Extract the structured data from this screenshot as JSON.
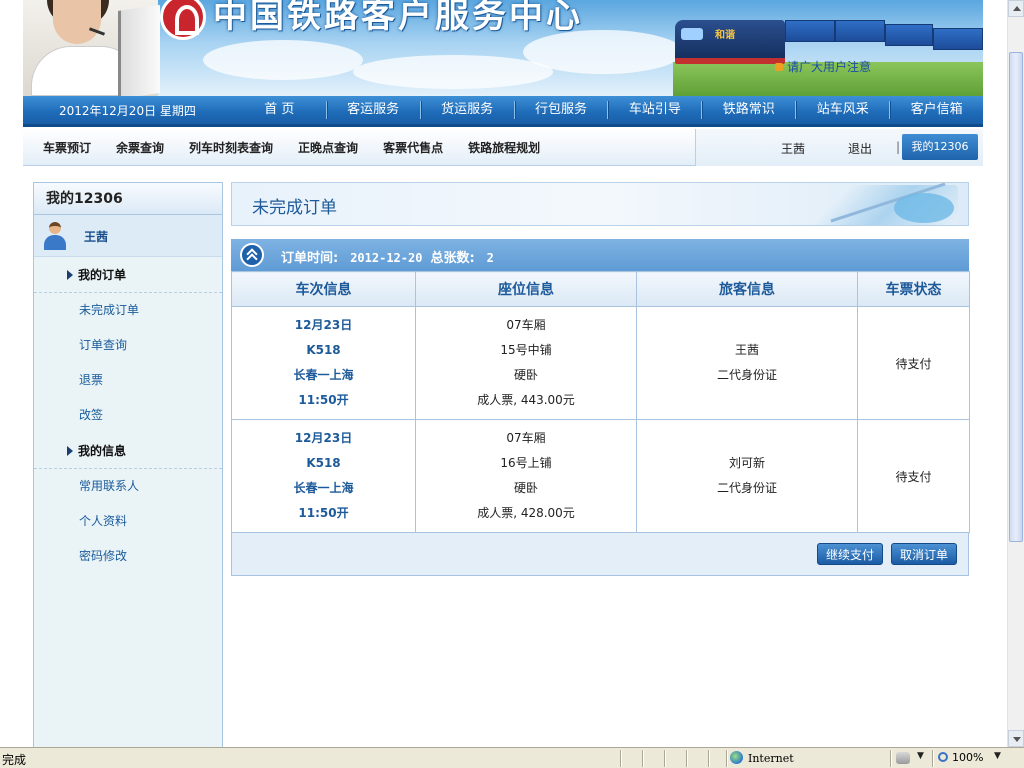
{
  "header": {
    "site_title": "中国铁路客户服务中心",
    "notice": "请广大用户注意",
    "loco_brand": "和谐"
  },
  "main_nav": {
    "date": "2012年12月20日  星期四",
    "items": [
      "首 页",
      "客运服务",
      "货运服务",
      "行包服务",
      "车站引导",
      "铁路常识",
      "站车风采",
      "客户信箱"
    ]
  },
  "sub_nav": {
    "links": [
      "车票预订",
      "余票查询",
      "列车时刻表查询",
      "正晚点查询",
      "客票代售点",
      "铁路旅程规划"
    ],
    "user_name": "王茜",
    "logout": "退出",
    "separator": "|",
    "my12306": "我的12306"
  },
  "sidebar": {
    "title": "我的12306",
    "user_name": "王茜",
    "sections": [
      {
        "label": "我的订单",
        "items": [
          "未完成订单",
          "订单查询",
          "退票",
          "改签"
        ]
      },
      {
        "label": "我的信息",
        "items": [
          "常用联系人",
          "个人资料",
          "密码修改"
        ]
      }
    ]
  },
  "content": {
    "title": "未完成订单",
    "order_bar": {
      "time_label": "订单时间:",
      "time_value": "2012-12-20",
      "count_label": "总张数:",
      "count_value": "2"
    },
    "table": {
      "headers": [
        "车次信息",
        "座位信息",
        "旅客信息",
        "车票状态"
      ],
      "rows": [
        {
          "train": [
            "12月23日",
            "K518",
            "长春一上海",
            "11:50开"
          ],
          "seat": [
            "07车厢",
            "15号中铺",
            "硬卧",
            "成人票, 443.00元"
          ],
          "passenger": [
            "王茜",
            "二代身份证"
          ],
          "status": "待支付"
        },
        {
          "train": [
            "12月23日",
            "K518",
            "长春一上海",
            "11:50开"
          ],
          "seat": [
            "07车厢",
            "16号上铺",
            "硬卧",
            "成人票, 428.00元"
          ],
          "passenger": [
            "刘可新",
            "二代身份证"
          ],
          "status": "待支付"
        }
      ]
    },
    "buttons": {
      "continue_pay": "继续支付",
      "cancel_order": "取消订单"
    }
  },
  "statusbar": {
    "status": "完成",
    "zone": "Internet",
    "zoom": "100%"
  }
}
